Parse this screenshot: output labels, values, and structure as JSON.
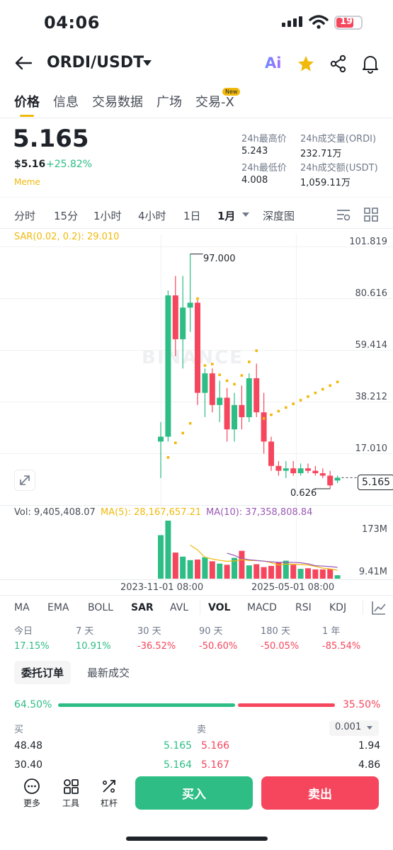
{
  "status": {
    "time": "04:06",
    "battery": "19"
  },
  "header": {
    "pair": "ORDI/USDT",
    "ai_label": "Ai"
  },
  "tabs": [
    {
      "label": "价格"
    },
    {
      "label": "信息"
    },
    {
      "label": "交易数据"
    },
    {
      "label": "广场"
    },
    {
      "label": "交易-X",
      "badge": "New"
    }
  ],
  "price": {
    "last": "5.165",
    "usd": "$5.16",
    "change": "+25.82%",
    "tag": "Meme"
  },
  "stats": {
    "high_label": "24h最高价",
    "high": "5.243",
    "low_label": "24h最低价",
    "low": "4.008",
    "vol_label": "24h成交量(ORDI)",
    "vol": "232.71万",
    "amt_label": "24h成交额(USDT)",
    "amt": "1,059.11万"
  },
  "intervals": [
    "分时",
    "15分",
    "1小时",
    "4小时",
    "1日",
    "1月",
    "深度图"
  ],
  "active_interval": "1月",
  "chart": {
    "sar_label": "SAR(0.02, 0.2): 29.010",
    "y_ticks": [
      "101.819",
      "80.616",
      "59.414",
      "38.212",
      "17.010"
    ],
    "high_label": "97.000",
    "low_label": "0.626",
    "current_price": "5.165",
    "watermark": "BINANCE",
    "vol_label": "Vol: 9,405,408.07",
    "ma5_label": "MA(5): 28,167,657.21",
    "ma10_label": "MA(10): 37,358,808.84",
    "vol_ticks": [
      "173M",
      "9.41M"
    ],
    "x_labels": [
      "2023-11-01 08:00",
      "2025-05-01 08:00"
    ]
  },
  "chart_data": {
    "type": "candlestick",
    "ylim": [
      0.626,
      101.819
    ],
    "candles_ohlc": [
      [
        20,
        28,
        5,
        22
      ],
      [
        22,
        82,
        20,
        80
      ],
      [
        80,
        88,
        55,
        62
      ],
      [
        62,
        88,
        50,
        75
      ],
      [
        75,
        97,
        65,
        77
      ],
      [
        77,
        78,
        35,
        40
      ],
      [
        40,
        50,
        30,
        48
      ],
      [
        48,
        50,
        32,
        35
      ],
      [
        35,
        45,
        28,
        38
      ],
      [
        38,
        42,
        20,
        25
      ],
      [
        25,
        40,
        20,
        35
      ],
      [
        35,
        43,
        25,
        30
      ],
      [
        30,
        48,
        28,
        46
      ],
      [
        46,
        52,
        30,
        32
      ],
      [
        32,
        40,
        15,
        20
      ],
      [
        20,
        22,
        8,
        10
      ],
      [
        10,
        12,
        6,
        8
      ],
      [
        8,
        12,
        5,
        9
      ],
      [
        9,
        12,
        6,
        7
      ],
      [
        7,
        11,
        6,
        9
      ],
      [
        9,
        11,
        7,
        8
      ],
      [
        8,
        10,
        6,
        7
      ],
      [
        7,
        9,
        5,
        6
      ],
      [
        6,
        8,
        0.626,
        2
      ],
      [
        4,
        6,
        3,
        5.165
      ]
    ],
    "volume_scale": [
      "9.41M",
      "173M"
    ]
  },
  "indicators": [
    "MA",
    "EMA",
    "BOLL",
    "SAR",
    "AVL",
    "VOL",
    "MACD",
    "RSI",
    "KDJ"
  ],
  "active_main": "SAR",
  "active_sub": "VOL",
  "performance": [
    {
      "label": "今日",
      "value": "17.15%",
      "dir": "up"
    },
    {
      "label": "7 天",
      "value": "10.91%",
      "dir": "up"
    },
    {
      "label": "30 天",
      "value": "-36.52%",
      "dir": "down"
    },
    {
      "label": "90 天",
      "value": "-50.60%",
      "dir": "down"
    },
    {
      "label": "180 天",
      "value": "-50.05%",
      "dir": "down"
    },
    {
      "label": "1 年",
      "value": "-85.54%",
      "dir": "down"
    }
  ],
  "orderbook": {
    "tab_active": "委托订单",
    "tab_other": "最新成交",
    "buy_pct": "64.50%",
    "sell_pct": "35.50%",
    "buy_ratio": 0.645,
    "buy_label": "买",
    "sell_label": "卖",
    "precision": "0.001",
    "rows": [
      {
        "bid_qty": "48.48",
        "bid": "5.165",
        "ask": "5.166",
        "ask_qty": "1.94"
      },
      {
        "bid_qty": "30.40",
        "bid": "5.164",
        "ask": "5.167",
        "ask_qty": "4.86"
      }
    ]
  },
  "bottom": {
    "more": "更多",
    "tools": "工具",
    "leverage": "杠杆",
    "buy": "买入",
    "sell": "卖出"
  },
  "colors": {
    "up": "#2ebd85",
    "down": "#f6465d",
    "accent": "#f0b90b",
    "ma10": "#9b59b6"
  }
}
